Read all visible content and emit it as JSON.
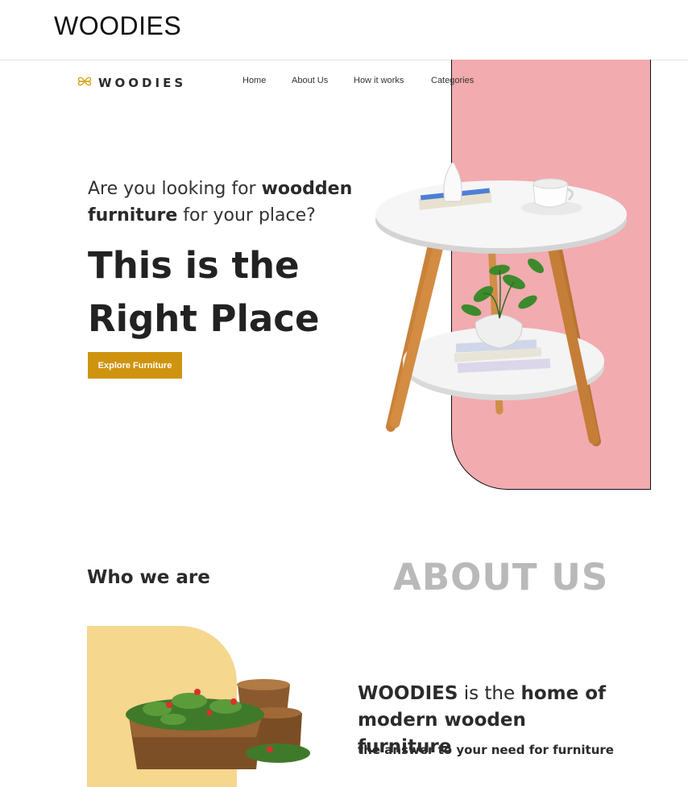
{
  "banner": {
    "title": "WOODIES"
  },
  "nav": {
    "logo_text": "WOODIES",
    "links": [
      "Home",
      "About Us",
      "How it works",
      "Categories"
    ]
  },
  "hero": {
    "sub_line1_pre": "Are you looking for ",
    "sub_line1_bold": "woodden",
    "sub_line2_bold": "furniture",
    "sub_line2_post": " for your place?",
    "title_line1": "This is the",
    "title_line2": "Right Place",
    "button_label": "Explore Furniture"
  },
  "about": {
    "heading": "Who we are",
    "watermark": "ABOUT US",
    "headline_bold1": "WOODIES",
    "headline_mid": " is the ",
    "headline_bold2": "home of modern wooden furniture",
    "tagline": "the answer to your need for furniture"
  },
  "colors": {
    "accent": "#cf940f",
    "pink_panel": "#f2abaf",
    "yellow_shape": "#f5d78e",
    "watermark": "#b9b9b9"
  },
  "icons": {
    "logo": "flower-logo-icon"
  }
}
